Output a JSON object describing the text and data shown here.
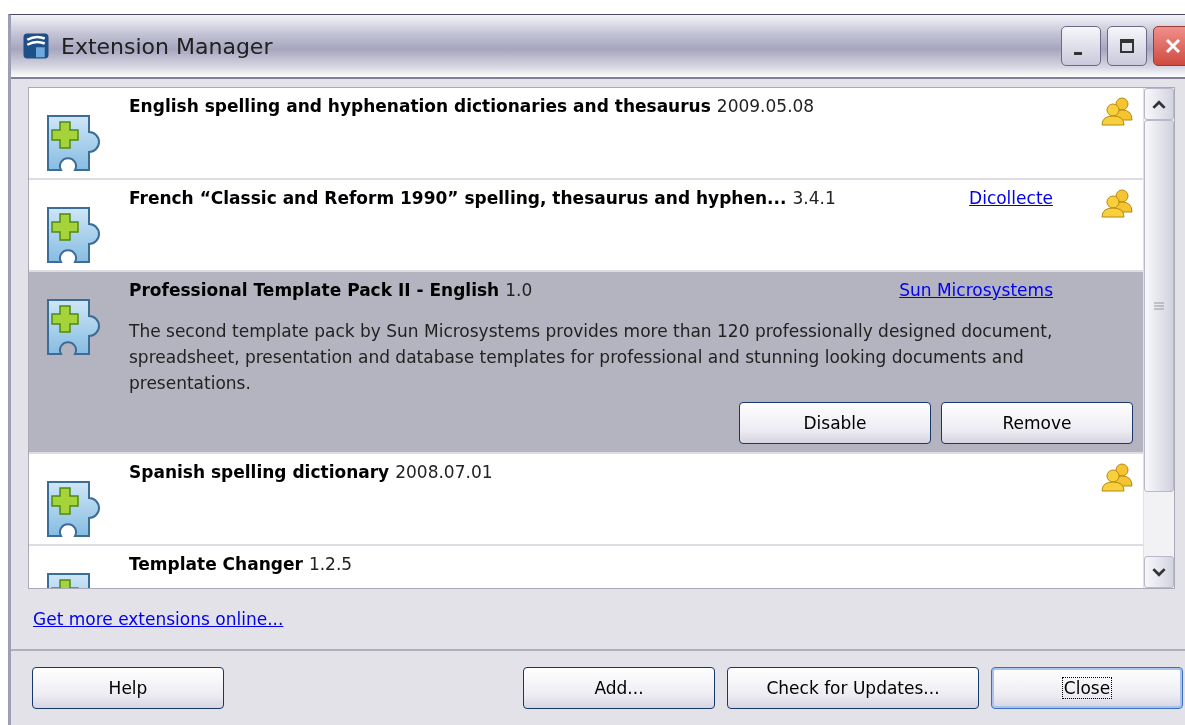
{
  "window": {
    "title": "Extension Manager"
  },
  "extensions": [
    {
      "title": "English spelling and hyphenation dictionaries and thesaurus",
      "version": "2009.05.08",
      "shared": true,
      "selected": false
    },
    {
      "title": "French “Classic and Reform 1990” spelling, thesaurus and hyphen...",
      "version": "3.4.1",
      "publisher": "Dicollecte",
      "shared": true,
      "selected": false
    },
    {
      "title": "Professional Template Pack II - English",
      "version": "1.0",
      "publisher": "Sun Microsystems",
      "shared": false,
      "selected": true,
      "description": "The second template pack by Sun Microsystems provides more than 120 professionally designed document, spreadsheet, presentation and database templates for professional and stunning looking documents and presentations.",
      "buttons": [
        "Disable",
        "Remove"
      ]
    },
    {
      "title": "Spanish spelling dictionary",
      "version": "2008.07.01",
      "shared": true,
      "selected": false
    },
    {
      "title": "Template Changer",
      "version": "1.2.5",
      "shared": false,
      "selected": false
    }
  ],
  "more_link": "Get more extensions online...",
  "buttons": [
    {
      "label": "Help",
      "kind": "left",
      "focused": false
    },
    {
      "label": "Add...",
      "kind": "right",
      "focused": false
    },
    {
      "label": "Check for Updates...",
      "kind": "right",
      "focused": false
    },
    {
      "label": "Close",
      "kind": "right",
      "focused": true
    }
  ]
}
